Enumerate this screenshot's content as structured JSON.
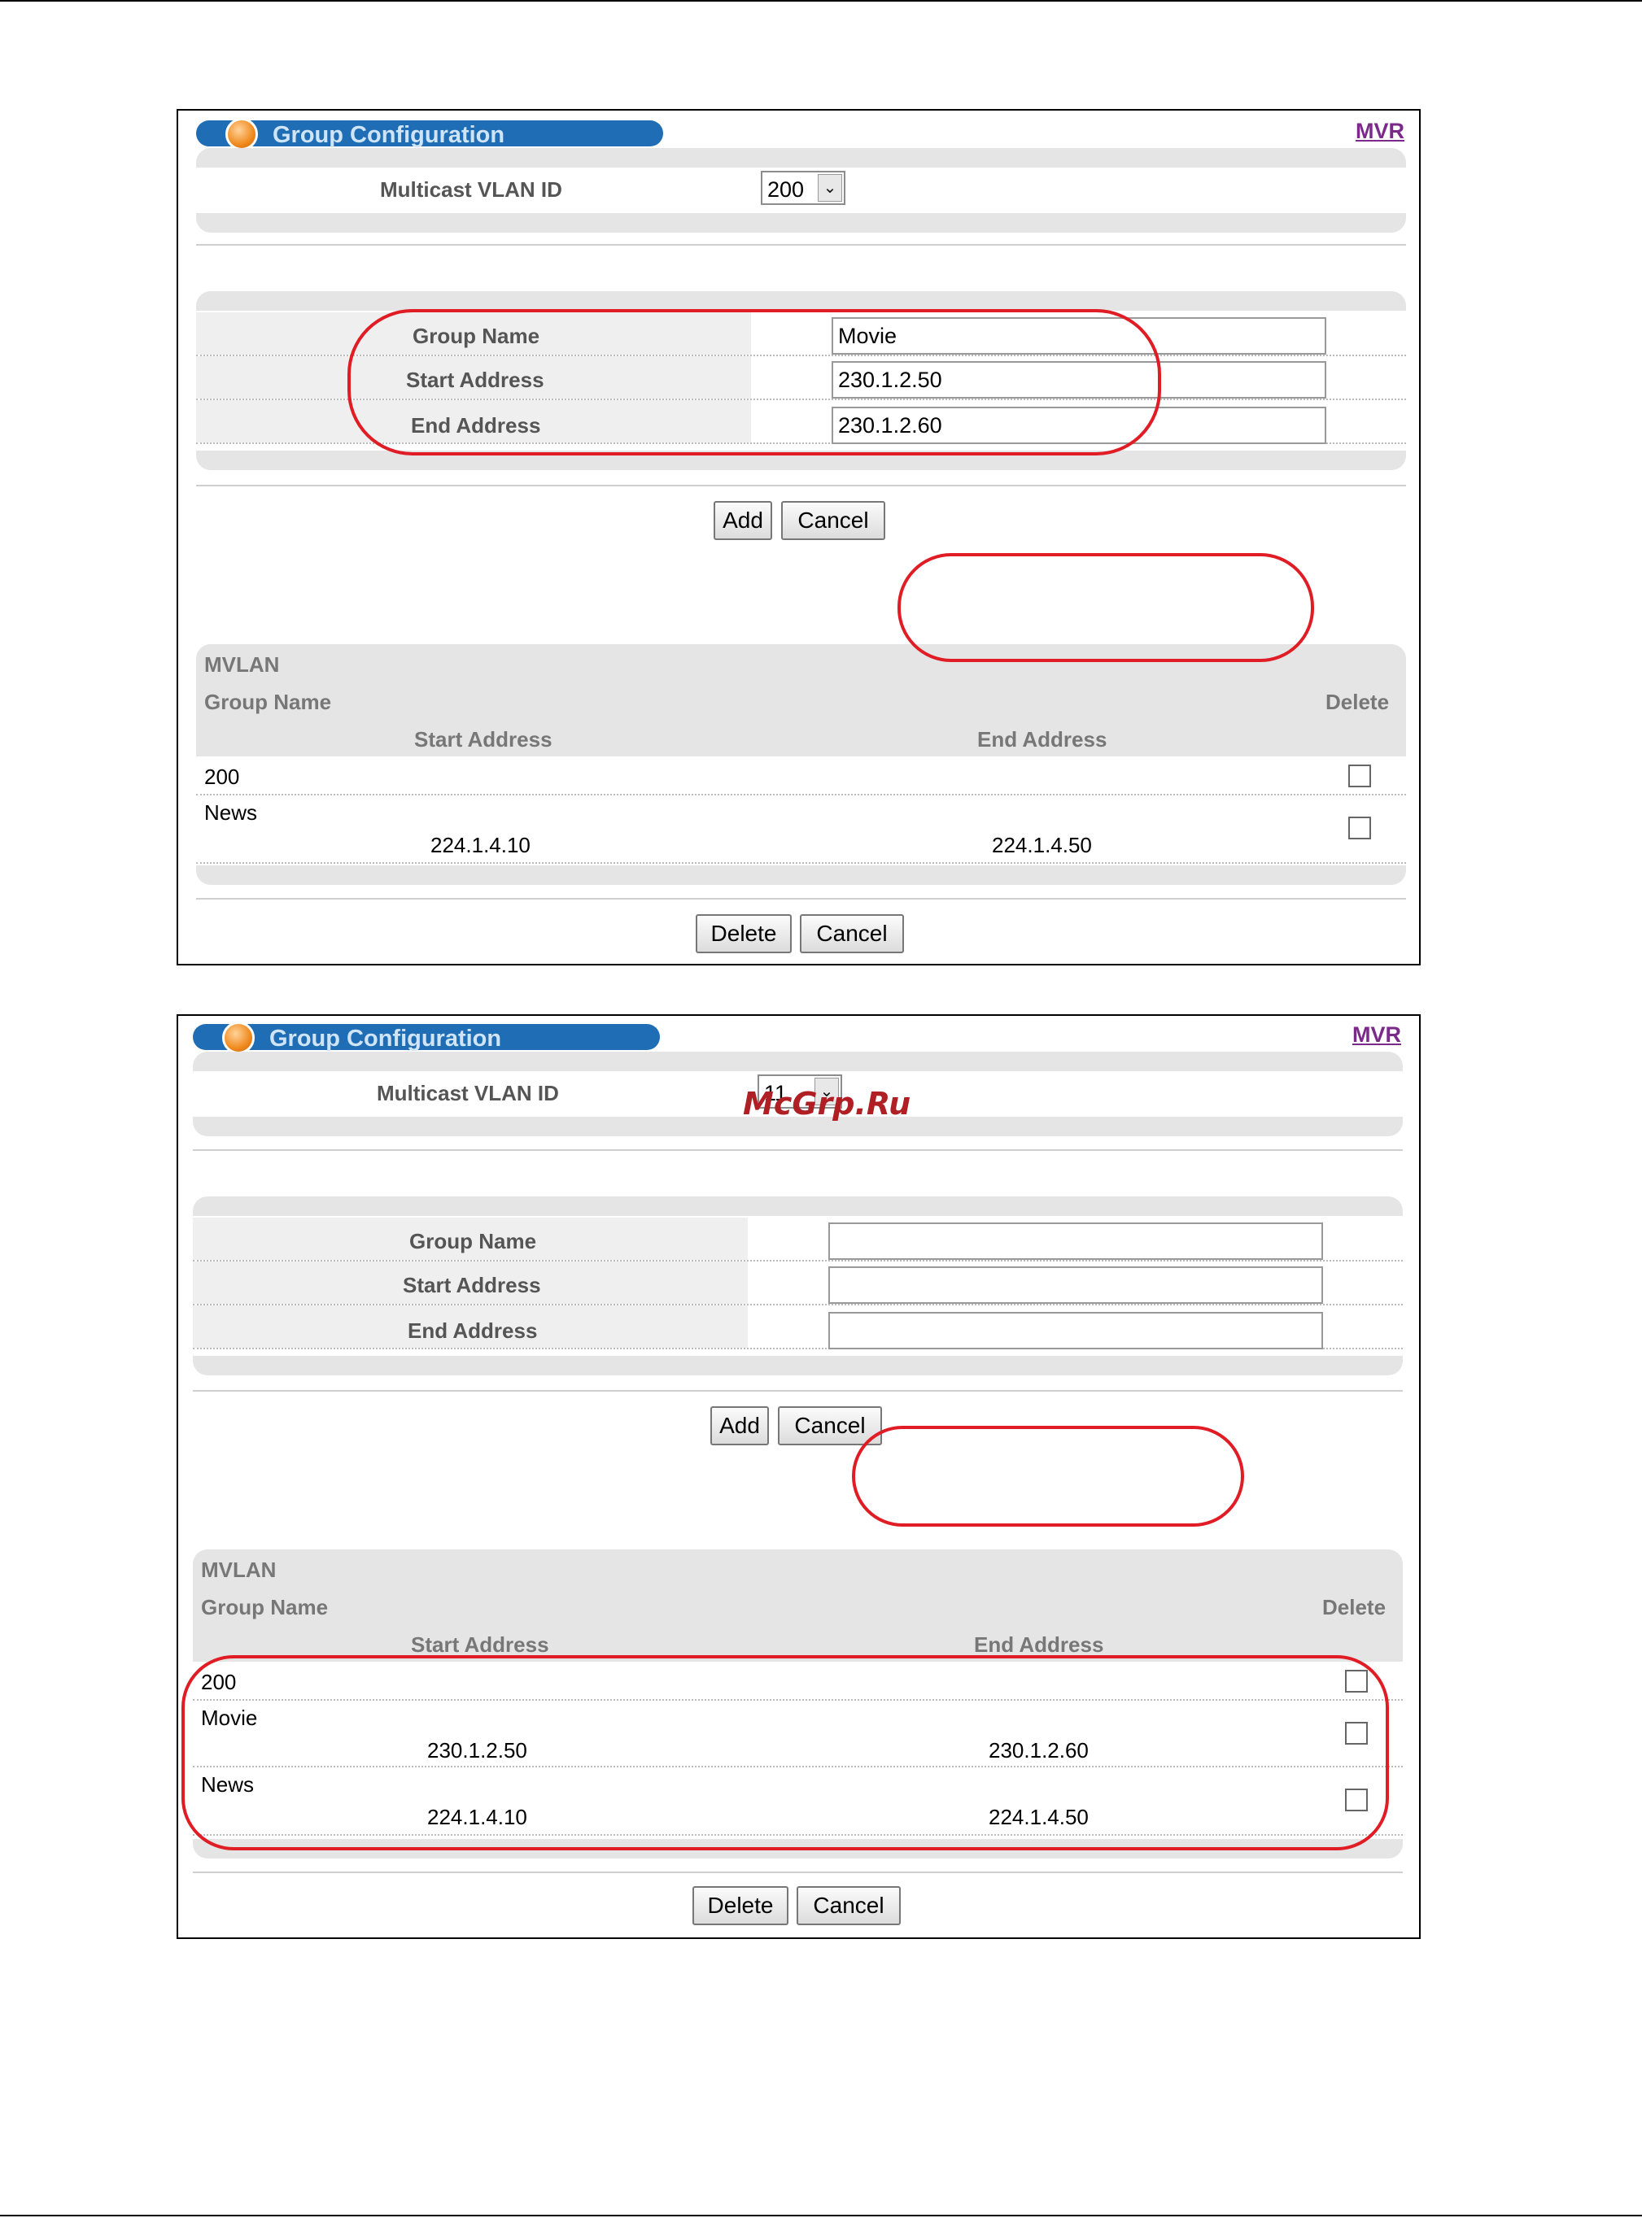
{
  "watermark": "McGrp.Ru",
  "screen1": {
    "title": "Group Configuration",
    "mvr_link": "MVR",
    "vlan_label": "Multicast VLAN ID",
    "vlan_value": "200",
    "form": {
      "group_name_label": "Group Name",
      "group_name_value": "Movie",
      "start_label": "Start Address",
      "start_value": "230.1.2.50",
      "end_label": "End Address",
      "end_value": "230.1.2.60"
    },
    "add_label": "Add",
    "cancel_label": "Cancel",
    "table": {
      "hdr_mvlan": "MVLAN",
      "hdr_group": "Group Name",
      "hdr_delete": "Delete",
      "hdr_start": "Start Address",
      "hdr_end": "End Address",
      "mvlan": "200",
      "rows": [
        {
          "group": "News",
          "start": "224.1.4.10",
          "end": "224.1.4.50"
        }
      ]
    },
    "delete_label": "Delete",
    "cancel2_label": "Cancel"
  },
  "screen2": {
    "title": "Group Configuration",
    "mvr_link": "MVR",
    "vlan_label": "Multicast VLAN ID",
    "vlan_value": "11",
    "form": {
      "group_name_label": "Group Name",
      "group_name_value": "",
      "start_label": "Start Address",
      "start_value": "",
      "end_label": "End Address",
      "end_value": ""
    },
    "add_label": "Add",
    "cancel_label": "Cancel",
    "table": {
      "hdr_mvlan": "MVLAN",
      "hdr_group": "Group Name",
      "hdr_delete": "Delete",
      "hdr_start": "Start Address",
      "hdr_end": "End Address",
      "mvlan": "200",
      "rows": [
        {
          "group": "Movie",
          "start": "230.1.2.50",
          "end": "230.1.2.60"
        },
        {
          "group": "News",
          "start": "224.1.4.10",
          "end": "224.1.4.50"
        }
      ]
    },
    "delete_label": "Delete",
    "cancel2_label": "Cancel"
  }
}
